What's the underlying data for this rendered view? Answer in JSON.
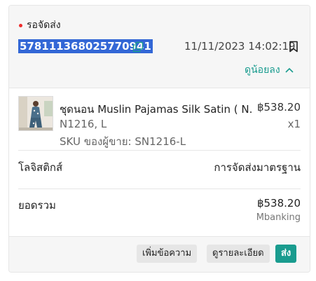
{
  "header": {
    "status_label": "รอจัดส่ง",
    "order_id": "578111368025770941",
    "datetime": "11/11/2023 14:02:19",
    "collapse_label": "ดูน้อยลง"
  },
  "product": {
    "name": "ชุดนอน Muslin Pajamas Silk Satin ( N...",
    "price": "฿538.20",
    "variant": "N1216, L",
    "quantity": "x1",
    "sku": "SKU ของผู้ขาย: SN1216-L"
  },
  "logistics": {
    "label": "โลจิสติกส์",
    "value": "การจัดส่งมาตรฐาน"
  },
  "total": {
    "label": "ยอดรวม",
    "amount": "฿538.20",
    "payment_method": "Mbanking"
  },
  "actions": {
    "add_message": "เพิ่มข้อความ",
    "view_details": "ดูรายละเอียด",
    "ship": "ส่ง"
  },
  "colors": {
    "accent": "#1a9c8f",
    "status_dot": "#ee2c2c",
    "selection": "#3367d6"
  },
  "icons": [
    "copy-icon",
    "bookmark-icon",
    "chevron-up-icon"
  ]
}
